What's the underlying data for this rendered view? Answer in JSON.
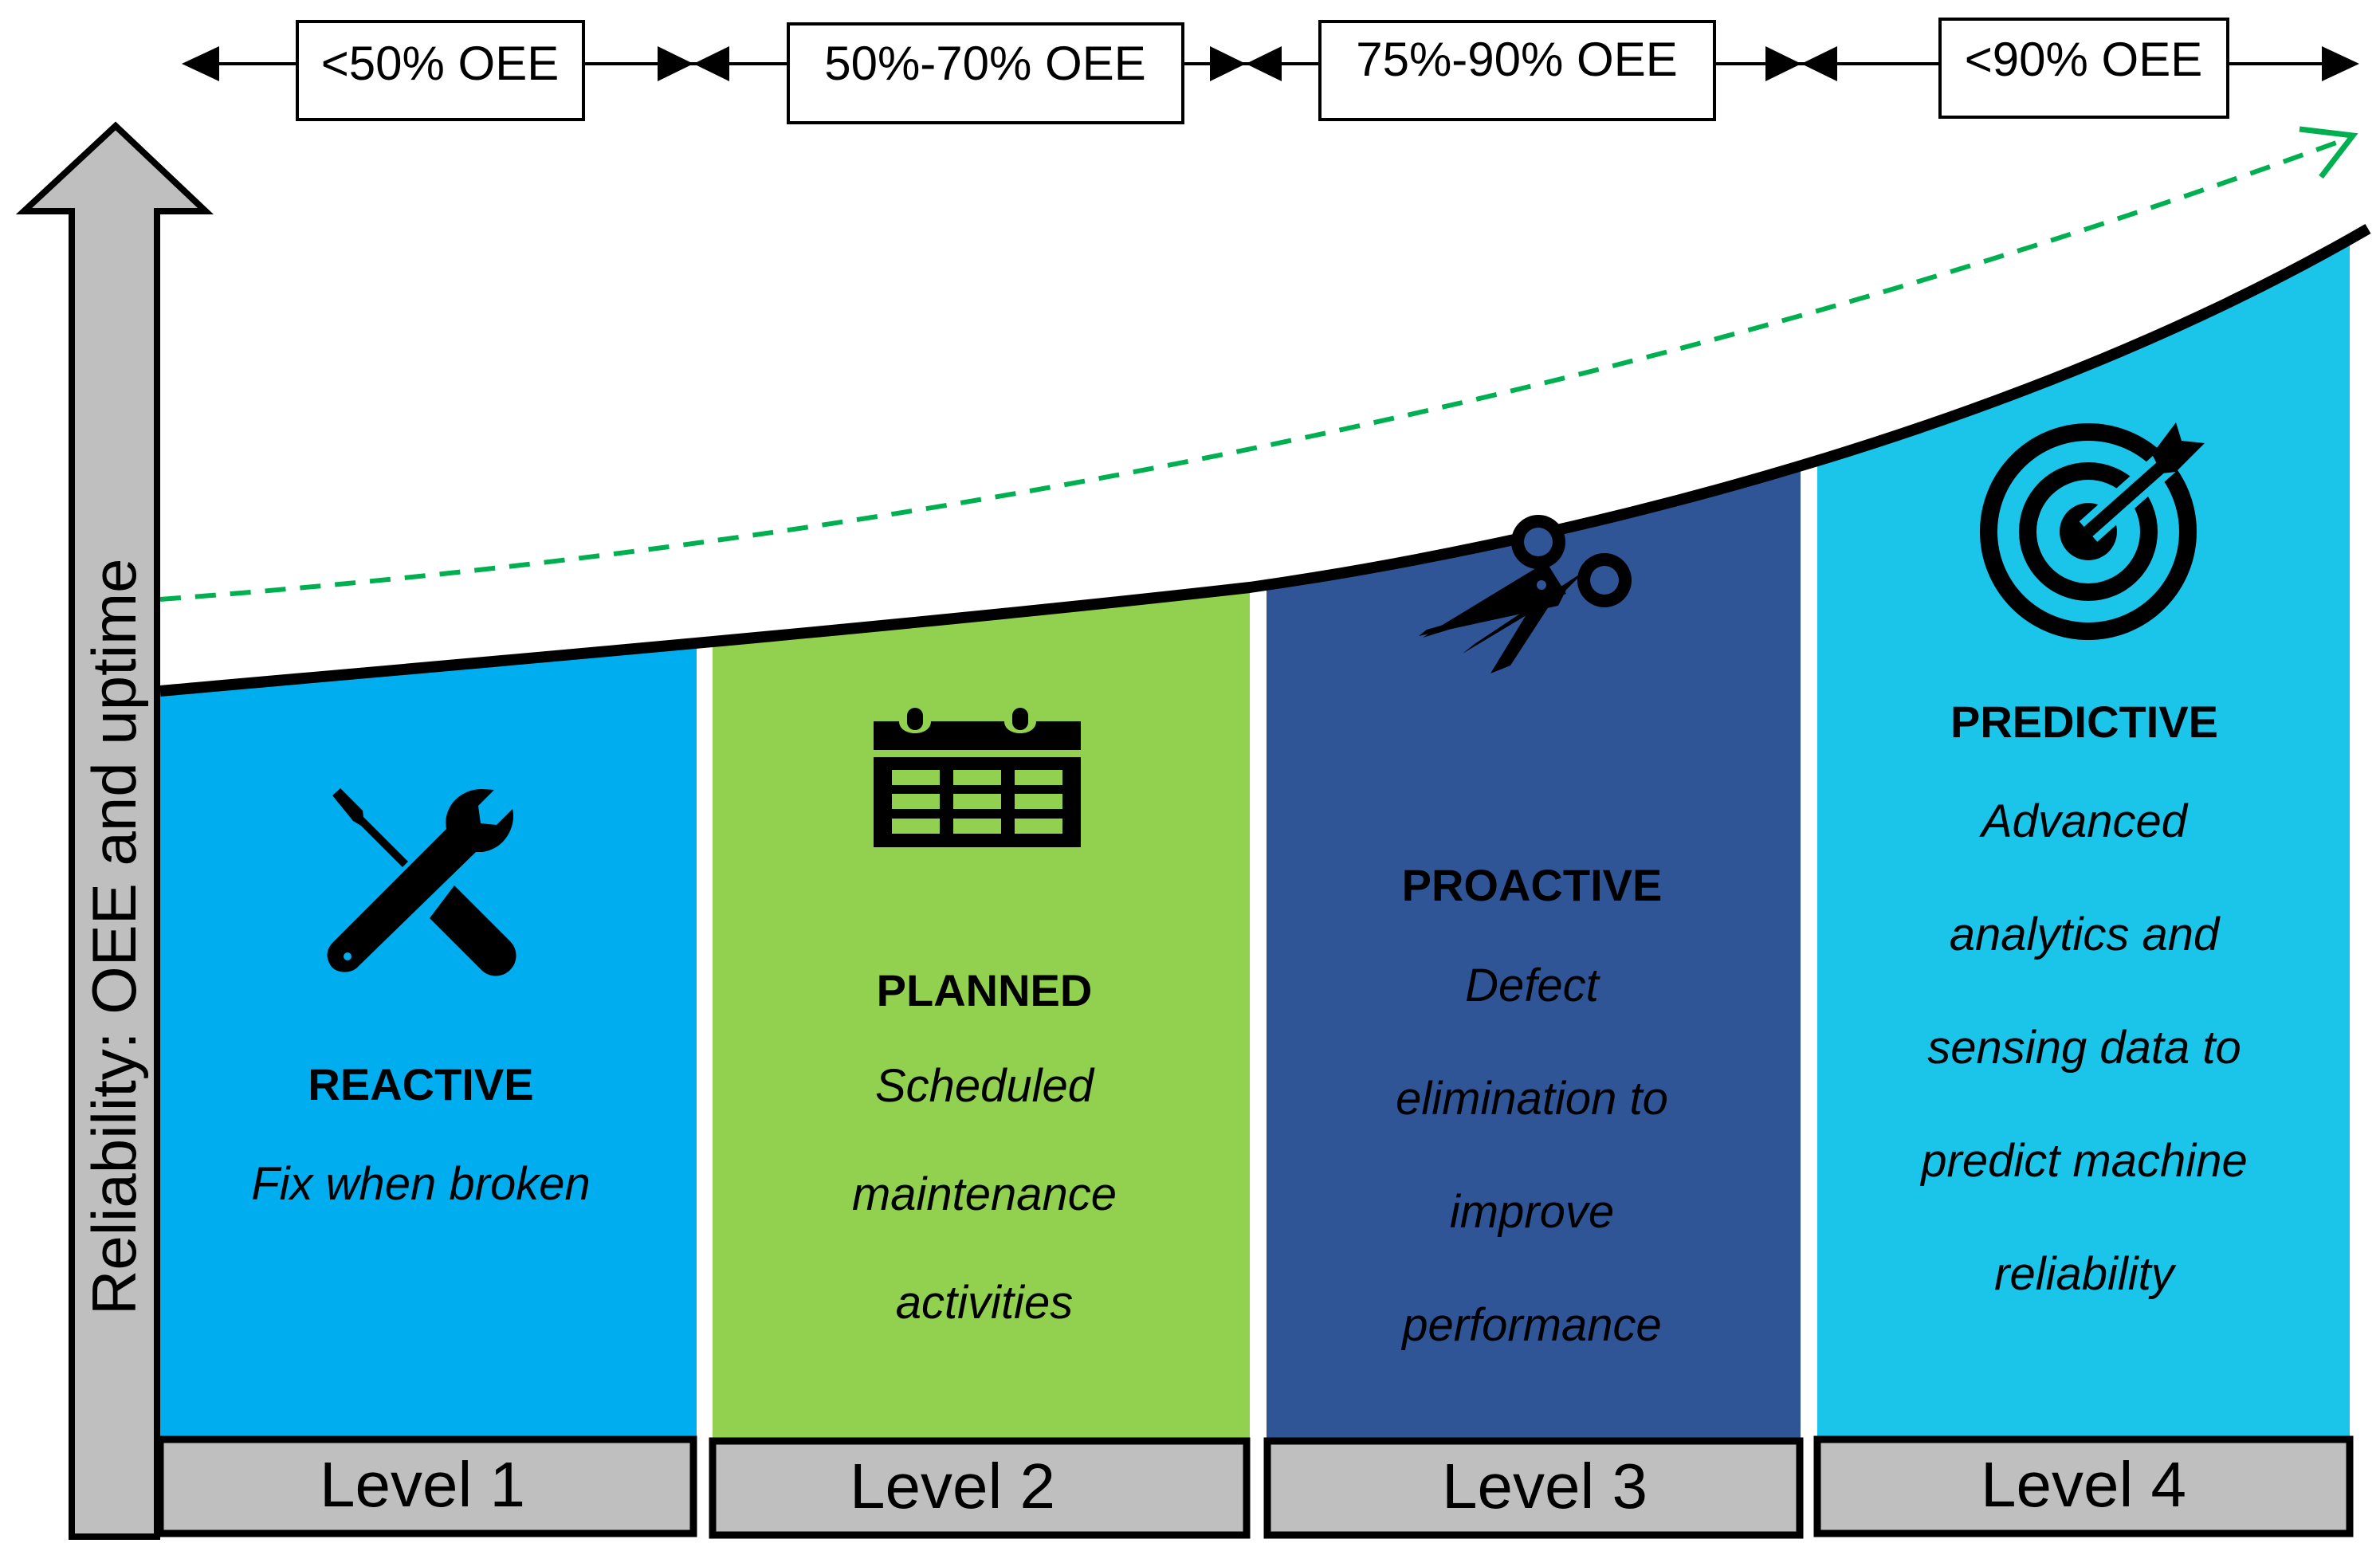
{
  "y_axis_label": "Reliability: OEE and uptime",
  "oee_ranges": [
    "<50% OEE",
    "50%-70% OEE",
    "75%-90% OEE",
    "<90% OEE"
  ],
  "levels": [
    {
      "level_label": "Level 1",
      "title": "REACTIVE",
      "description": [
        "Fix when broken"
      ],
      "icon": "wrench-screwdriver-icon",
      "color": "#00AEEF"
    },
    {
      "level_label": "Level 2",
      "title": "PLANNED",
      "description": [
        "Scheduled",
        "maintenance",
        "activities"
      ],
      "icon": "calendar-icon",
      "color": "#92D050"
    },
    {
      "level_label": "Level 3",
      "title": "PROACTIVE",
      "description": [
        "Defect",
        "elimination to",
        "improve",
        "performance"
      ],
      "icon": "scissors-icon",
      "color": "#2F5597"
    },
    {
      "level_label": "Level 4",
      "title": "PREDICTIVE",
      "description": [
        "Advanced",
        "analytics and",
        "sensing data to",
        "predict machine",
        "reliability"
      ],
      "icon": "target-arrow-icon",
      "color": "#1BC5E9"
    }
  ],
  "colors": {
    "axis_gray": "#BFBFBF",
    "trend_green": "#00B050",
    "curve": "#000000"
  }
}
